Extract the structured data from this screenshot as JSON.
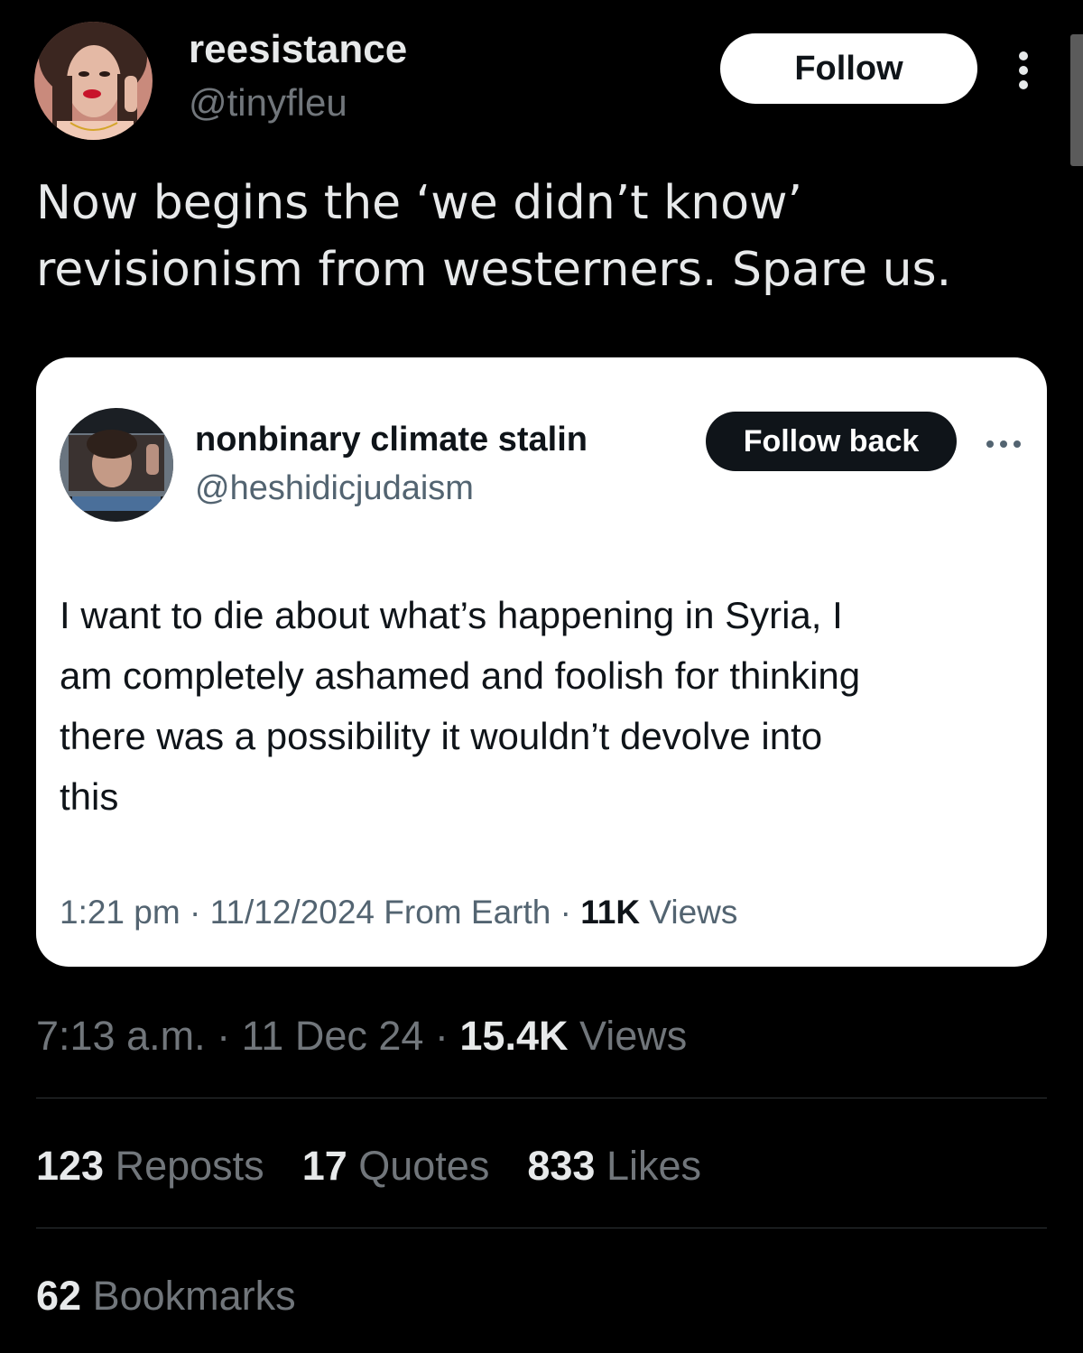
{
  "author": {
    "display_name": "reesistance",
    "handle": "@tinyfleu",
    "follow_label": "Follow"
  },
  "tweet": {
    "text": "Now begins the ‘we didn’t know’\nrevisionism from westerners. Spare us."
  },
  "quoted_tweet": {
    "display_name": "nonbinary climate stalin",
    "handle": "@heshidicjudaism",
    "follow_back_label": "Follow back",
    "text": "I want to die about what’s happening in Syria, I\nam completely ashamed and foolish for thinking\nthere was a possibility it wouldn’t devolve into\nthis",
    "meta_prefix": "1:21 pm · 11/12/2024 From Earth · ",
    "views_count": "11K",
    "views_label": " Views"
  },
  "meta": {
    "time": "7:13 a.m.",
    "sep1": " · ",
    "date": "11 Dec 24",
    "sep2": " · ",
    "views_count": "15.4K",
    "views_label": " Views"
  },
  "stats": {
    "reposts_count": "123",
    "reposts_label": " Reposts",
    "quotes_count": "17",
    "quotes_label": " Quotes",
    "likes_count": "833",
    "likes_label": " Likes",
    "bookmarks_count": "62",
    "bookmarks_label": " Bookmarks"
  },
  "colors": {
    "background": "#000000",
    "primary_text": "#e7e9ea",
    "secondary_text": "#71767b",
    "card_background": "#ffffff",
    "divider": "#2f3336"
  }
}
